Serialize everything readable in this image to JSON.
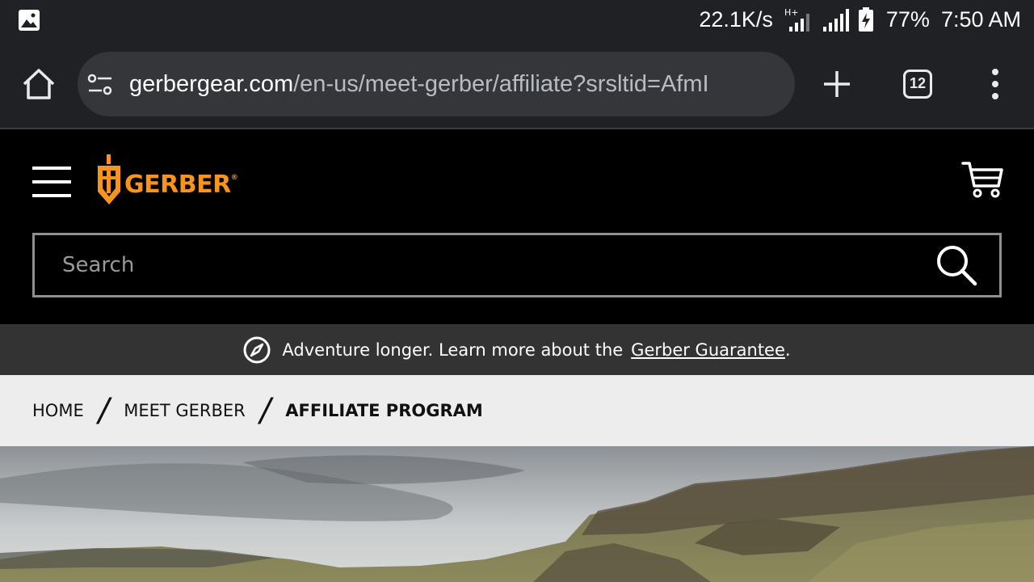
{
  "status_bar": {
    "net_speed": "22.1K/s",
    "network_type": "H+",
    "battery": "77%",
    "time": "7:50 AM"
  },
  "browser": {
    "url_domain": "gerbergear.com",
    "url_path": "/en-us/meet-gerber/affiliate?srsltid=AfmI",
    "tab_count": "12"
  },
  "header": {
    "logo_text": "GERBER",
    "search_placeholder": "Search"
  },
  "promo": {
    "text": "Adventure longer. Learn more about the",
    "link_text": "Gerber Guarantee",
    "suffix": "."
  },
  "breadcrumb": {
    "items": [
      "HOME",
      "MEET GERBER"
    ],
    "separator": "/",
    "current": "AFFILIATE PROGRAM"
  },
  "colors": {
    "brand_orange": "#f7941d",
    "chrome_bg": "#202124",
    "omnibox_bg": "#35363a",
    "promo_bg": "#333333",
    "breadcrumb_bg": "#ededed"
  }
}
